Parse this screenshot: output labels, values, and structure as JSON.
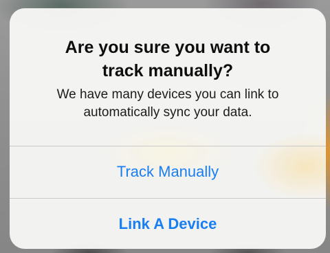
{
  "alert": {
    "title_line1": "Are you sure you want to",
    "title_line2": "track manually?",
    "message_line1": "We have many devices you can link to",
    "message_line2": "automatically sync your data."
  },
  "actions": {
    "track_manually_label": "Track Manually",
    "link_device_label": "Link A Device"
  },
  "colors": {
    "action_tint": "#1a7ef3",
    "title_text": "#0e0e0e",
    "dialog_background": "#f6f6f4",
    "separator": "#c9c9c7"
  }
}
